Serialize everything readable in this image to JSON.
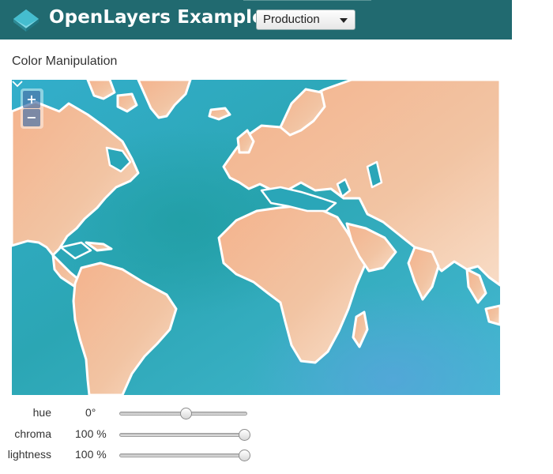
{
  "header": {
    "brand": "OpenLayers Examples",
    "build_selector": {
      "selected": "Production"
    },
    "colors": {
      "background": "#216a70",
      "logo": "#46bfd0"
    }
  },
  "page": {
    "title": "Color Manipulation"
  },
  "map": {
    "zoom_in_label": "+",
    "zoom_out_label": "−",
    "style": "watercolor"
  },
  "controls": [
    {
      "id": "hue",
      "label": "hue",
      "value_text": "0°",
      "level": 0.52
    },
    {
      "id": "chroma",
      "label": "chroma",
      "value_text": "100 %",
      "level": 1.0
    },
    {
      "id": "lightness",
      "label": "lightness",
      "value_text": "100 %",
      "level": 1.0
    }
  ]
}
